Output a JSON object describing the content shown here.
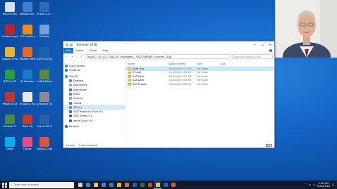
{
  "desktop": {
    "icons": [
      {
        "label": "Recycle Bin",
        "icon": "recycle-bin-icon",
        "color": "#d8dfe8"
      },
      {
        "label": "WebSource Summer",
        "icon": "websource-icon",
        "color": "#3b7fd4"
      },
      {
        "label": "R x64 3.3.1",
        "icon": "r-icon",
        "color": "#2a6ab8"
      },
      {
        "label": "Adobe Acrobat DC",
        "icon": "acrobat-icon",
        "color": "#c9211e"
      },
      {
        "label": "VLC media player",
        "icon": "vlc-icon",
        "color": "#f08a1c"
      },
      {
        "label": "RStudio",
        "icon": "rstudio-icon",
        "color": "#6fa3d8"
      },
      {
        "label": "Google Chrome",
        "icon": "chrome-icon",
        "color": "#e9b530"
      },
      {
        "label": "Mozilla Firefox",
        "icon": "firefox-icon",
        "color": "#e66a1f"
      },
      {
        "label": "SAS 9.4 (English)",
        "icon": "sas-icon",
        "color": "#1b64b0"
      },
      {
        "label": "JMP Pro 13",
        "icon": "jmp-icon",
        "color": "#2d9e3f"
      },
      {
        "label": "HP Solution Center",
        "icon": "hp-icon",
        "color": "#1d7ac7"
      },
      {
        "label": "LaTeX Editor",
        "icon": "latex-icon",
        "color": "#5b8a3a"
      },
      {
        "label": "Maple 2015",
        "icon": "maple-icon",
        "color": "#c4342d"
      },
      {
        "label": "Snipping Tool",
        "icon": "snipping-tool-icon",
        "color": "#e9e9e9"
      },
      {
        "label": "pXecutor (Shortcut)",
        "icon": "pxecutor-icon",
        "color": "#8c8c8c"
      },
      {
        "label": "Minitab 17",
        "icon": "minitab-icon",
        "color": "#4b8b3b"
      },
      {
        "label": "Stat 1.6",
        "icon": "stat-icon",
        "color": "#c23a2b"
      },
      {
        "label": "Oracle VM VirtualBox",
        "icon": "virtualbox-icon",
        "color": "#2c5fa8"
      },
      {
        "label": "Skype",
        "icon": "skype-icon",
        "color": "#00aff0"
      },
      {
        "label": "iTunes",
        "icon": "itunes-icon",
        "color": "#e54d8a"
      },
      {
        "label": "Kaltura CaptureSp...",
        "icon": "kaltura-icon",
        "color": "#e1513a"
      }
    ]
  },
  "window": {
    "title": "Summer 2018",
    "controls": {
      "minimize": "—",
      "maximize": "☐",
      "close": "✕"
    },
    "ribbon_tabs": [
      "File",
      "Home",
      "Share",
      "View"
    ],
    "address": "This PC  ›  OS (C:)  ›  SAS-UE  ›  myfolders  ›  STAT 4-6908  ›  Summer 2018",
    "search_placeholder": "Search Summer 2018",
    "nav": [
      {
        "label": "Quick access",
        "icon": "star-icon",
        "color": "#3a8fd8",
        "selected": false
      },
      {
        "label": "OneDrive",
        "icon": "cloud-icon",
        "color": "#2f7ad0",
        "selected": false
      },
      {
        "label": "This PC",
        "icon": "computer-icon",
        "color": "#4a9be0",
        "selected": false
      },
      {
        "label": "Desktop",
        "icon": "desktop-icon",
        "color": "#3a8fd8",
        "selected": false
      },
      {
        "label": "Documents",
        "icon": "documents-icon",
        "color": "#9aa9bd",
        "selected": false
      },
      {
        "label": "Downloads",
        "icon": "downloads-icon",
        "color": "#2f7ad0",
        "selected": false
      },
      {
        "label": "Music",
        "icon": "music-icon",
        "color": "#3a8fd8",
        "selected": false
      },
      {
        "label": "Pictures",
        "icon": "pictures-icon",
        "color": "#6bb0e8",
        "selected": false
      },
      {
        "label": "Videos",
        "icon": "videos-icon",
        "color": "#7a62c9",
        "selected": false
      },
      {
        "label": "OS (C:)",
        "icon": "drive-icon",
        "color": "#7f8c9b",
        "selected": true
      },
      {
        "label": "STAT Research Drive (R:)",
        "icon": "network-drive-icon",
        "color": "#4f6a86",
        "selected": false
      },
      {
        "label": "STAT Share (S:)",
        "icon": "network-drive-icon",
        "color": "#4f6a86",
        "selected": false
      },
      {
        "label": "daniel Drive (U:)",
        "icon": "network-drive-icon",
        "color": "#4f6a86",
        "selected": false
      },
      {
        "label": "Network",
        "icon": "network-icon",
        "color": "#2f7ad0",
        "selected": false
      }
    ],
    "columns": {
      "name": "Name",
      "date": "Date modified",
      "type": "Type",
      "size": "Size"
    },
    "files": [
      {
        "name": "Data Files",
        "date": "5/16/2018 9:27 AM",
        "type": "File folder",
        "size": "",
        "selected": true
      },
      {
        "name": "R Code",
        "date": "5/16/2018 9:26 AM",
        "type": "File folder",
        "size": "",
        "selected": false
      },
      {
        "name": "SAS Code",
        "date": "5/16/2018 9:27 AM",
        "type": "File folder",
        "size": "",
        "selected": false
      },
      {
        "name": "SAS Data",
        "date": "5/16/2018 9:26 AM",
        "type": "File folder",
        "size": "",
        "selected": false
      },
      {
        "name": "SAS Graphs",
        "date": "5/16/2018 9:26 AM",
        "type": "File folder",
        "size": "",
        "selected": false
      }
    ],
    "status": {
      "items": "5 items",
      "selected": "1 item selected"
    }
  },
  "taskbar": {
    "search_placeholder": "Type here to search",
    "apps": [
      {
        "icon": "task-view-icon",
        "color": "#cfd6df"
      },
      {
        "icon": "edge-icon",
        "color": "#1d8fe1"
      },
      {
        "icon": "file-explorer-icon",
        "color": "#e8c05a"
      },
      {
        "icon": "store-icon",
        "color": "#3d7fd6"
      },
      {
        "icon": "mail-icon",
        "color": "#2f7ad0"
      },
      {
        "icon": "chrome-icon",
        "color": "#e9b530"
      },
      {
        "icon": "firefox-icon",
        "color": "#e66a1f"
      },
      {
        "icon": "word-icon",
        "color": "#2b5fa8"
      },
      {
        "icon": "excel-icon",
        "color": "#217346"
      },
      {
        "icon": "powerpoint-icon",
        "color": "#c4472b"
      },
      {
        "icon": "explorer-window-icon",
        "color": "#e8c05a"
      },
      {
        "icon": "sas-icon",
        "color": "#1b64b0"
      },
      {
        "icon": "kaltura-icon",
        "color": "#e1513a"
      }
    ],
    "time": "9:28 AM",
    "date": "5/16/2018"
  }
}
